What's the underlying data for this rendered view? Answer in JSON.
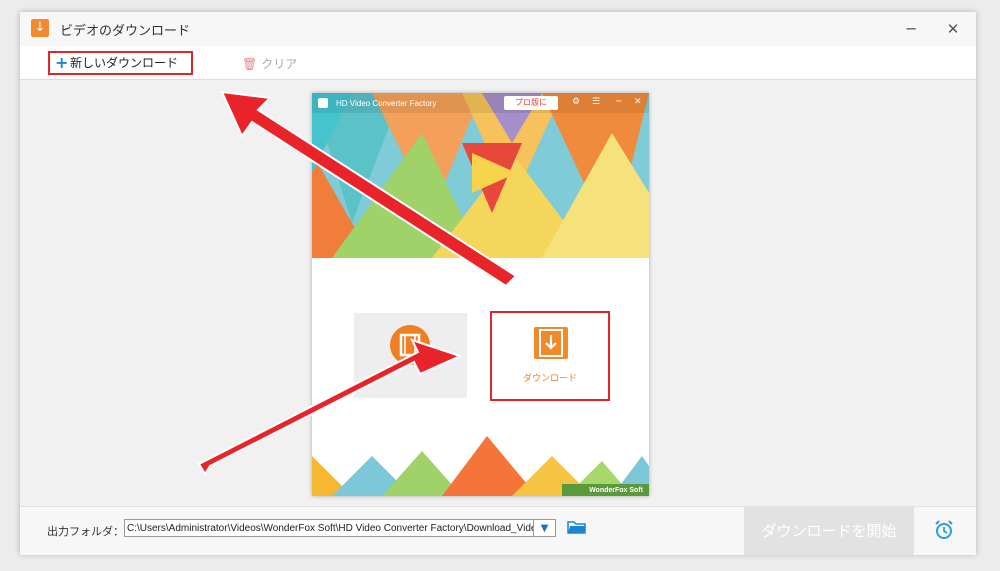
{
  "window": {
    "title": "ビデオのダウンロード",
    "app_icon": "download-arrow-icon",
    "minimize_symbol": "─",
    "close_symbol": "✕"
  },
  "toolbar": {
    "new_download_label": "新しいダウンロード",
    "new_download_icon": "plus-icon",
    "clear_label": "クリア",
    "clear_icon": "trash-icon"
  },
  "inner_screenshot": {
    "app_title": "HD Video Converter Factory",
    "pro_button": "プロ版に",
    "minimize_symbol": "─",
    "close_symbol": "✕",
    "download_tile_label": "ダウンロード",
    "brand": "WonderFox Soft"
  },
  "bottom": {
    "output_folder_label": "出力フォルダ：",
    "output_path": "C:\\Users\\Administrator\\Videos\\WonderFox Soft\\HD Video Converter Factory\\Download_Video\\",
    "download_all_label": "ダウンロードを開始",
    "folder_icon": "folder-open-icon",
    "alarm_icon": "alarm-clock-icon"
  },
  "colors": {
    "accent_blue": "#1b86d9",
    "highlight_red": "#e0262a",
    "orange": "#f07f24"
  }
}
